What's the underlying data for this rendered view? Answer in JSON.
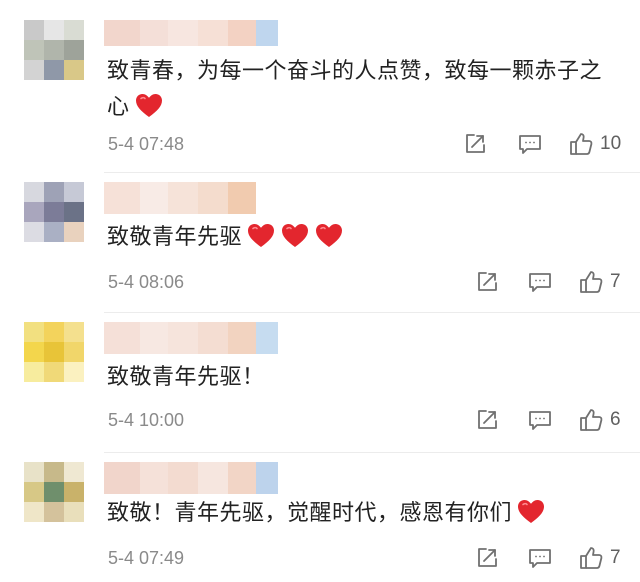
{
  "comments": [
    {
      "text": "致青春，为每一个奋斗的人点赞，致每一颗赤子之心",
      "hearts": 1,
      "time": "5-4 07:48",
      "likes": "10",
      "avatar_colors": [
        "#c9c9c9",
        "#e6e6e6",
        "#d9dcd3",
        "#bfc4b8",
        "#b0b5ab",
        "#9ea39a",
        "#d3d3d3",
        "#8f98a8",
        "#d9c888"
      ],
      "name_colors": [
        "#f2d6cc",
        "#f4dfd8",
        "#f7e6e0",
        "#f6e0d6",
        "#f3d2c3",
        "#bfd6ee"
      ]
    },
    {
      "text": "致敬青年先驱",
      "hearts": 3,
      "time": "5-4 08:06",
      "likes": "7",
      "avatar_colors": [
        "#d7d8df",
        "#9ea2b6",
        "#c6c9d6",
        "#a9a6bd",
        "#7c7c98",
        "#6b7287",
        "#dcdce3",
        "#aab0c4",
        "#e9d2be"
      ],
      "name_colors": [
        "#f6e1d8",
        "#f8ebe6",
        "#f6e3d9",
        "#f4dccd",
        "#f1cbaf"
      ]
    },
    {
      "text": "致敬青年先驱！",
      "hearts": 0,
      "time": "5-4 10:00",
      "likes": "6",
      "avatar_colors": [
        "#f2e080",
        "#f3d35c",
        "#f4e08e",
        "#f3d64c",
        "#e8c438",
        "#f1d66a",
        "#f7ec9e",
        "#f0d978",
        "#fbf1c0"
      ],
      "name_colors": [
        "#f5e0d8",
        "#f7e8e2",
        "#f6e4dc",
        "#f4ddd2",
        "#f2d3c0",
        "#c6dcf0"
      ]
    },
    {
      "text": "致敬！青年先驱，觉醒时代，感恩有你们",
      "hearts": 1,
      "time": "5-4 07:49",
      "likes": "7",
      "avatar_colors": [
        "#e8e2c8",
        "#c7b98a",
        "#efe8d2",
        "#d7c886",
        "#6f8f6c",
        "#c9b26a",
        "#efe6c8",
        "#d4c29c",
        "#e9dfbb"
      ],
      "name_colors": [
        "#f1d5cb",
        "#f5e1d9",
        "#f3dbd0",
        "#f6e6df",
        "#f2d5c6",
        "#bdd3ec"
      ]
    }
  ],
  "icons": {
    "share": "share-icon",
    "comment": "comment-icon",
    "like": "thumbs-up-icon",
    "heart": "red-heart-emoji"
  },
  "colors": {
    "heart": "#e3262e",
    "icon": "#707070",
    "time": "#8a8a8a"
  }
}
